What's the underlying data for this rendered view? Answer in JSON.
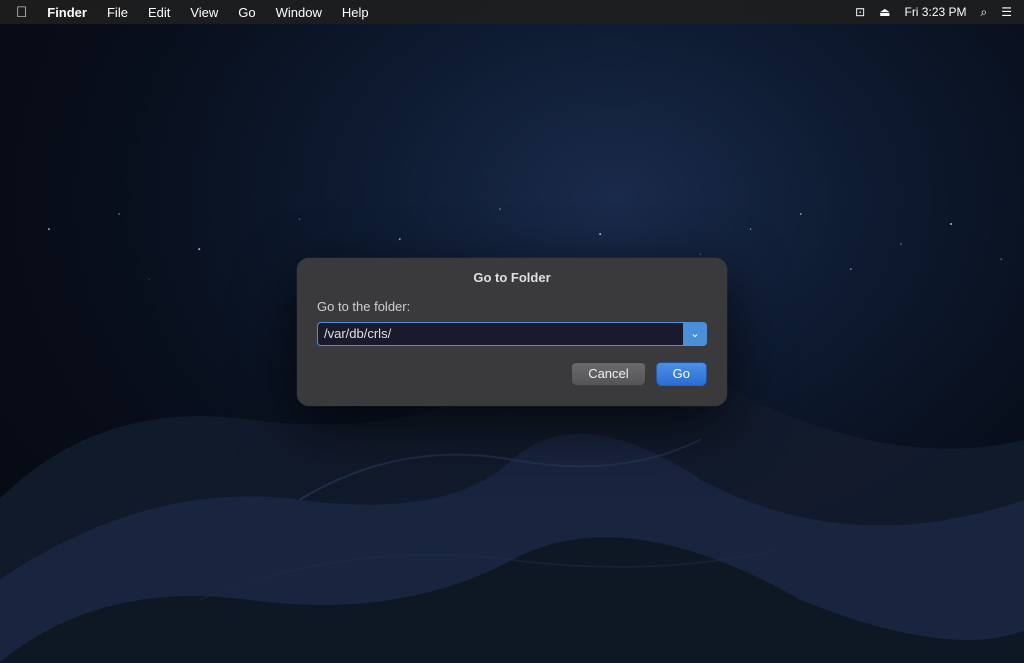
{
  "menubar": {
    "apple": "&#63743;",
    "app_name": "Finder",
    "menus": [
      "File",
      "Edit",
      "View",
      "Go",
      "Window",
      "Help"
    ],
    "right": {
      "time": "Fri 3:23 PM",
      "icons": [
        "screen-mirror-icon",
        "eject-icon",
        "search-icon",
        "menu-icon"
      ]
    }
  },
  "dialog": {
    "title": "Go to Folder",
    "label": "Go to the folder:",
    "input_value": "/var/db/crls/",
    "input_placeholder": "/var/db/crls/",
    "cancel_label": "Cancel",
    "go_label": "Go"
  }
}
